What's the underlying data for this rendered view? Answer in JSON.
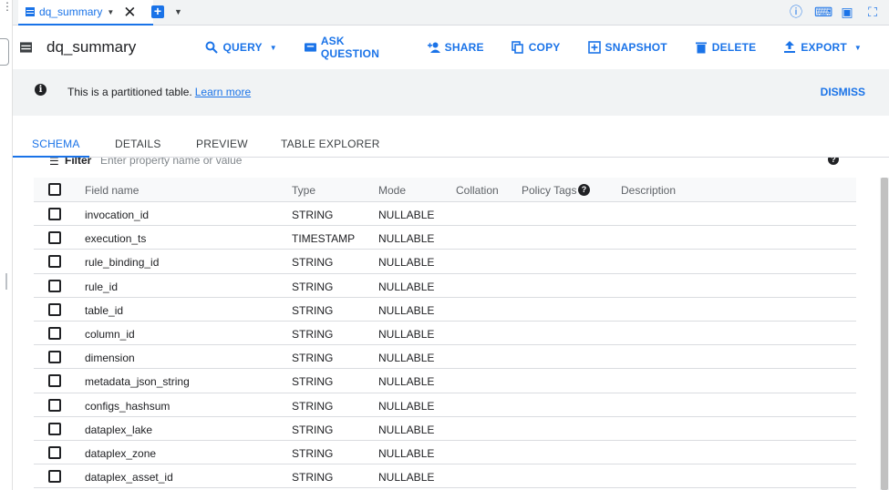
{
  "tab": {
    "label": "dq_summary"
  },
  "toolbar": {
    "title": "dq_summary",
    "query": "QUERY",
    "ask_question": "ASK QUESTION",
    "share": "SHARE",
    "copy": "COPY",
    "snapshot": "SNAPSHOT",
    "delete": "DELETE",
    "export": "EXPORT"
  },
  "banner": {
    "message": "This is a partitioned table.",
    "link": "Learn more",
    "dismiss": "DISMISS"
  },
  "detail_tabs": [
    "SCHEMA",
    "DETAILS",
    "PREVIEW",
    "TABLE EXPLORER"
  ],
  "filter": {
    "label": "Filter",
    "placeholder": "Enter property name or value"
  },
  "columns": {
    "field_name": "Field name",
    "type": "Type",
    "mode": "Mode",
    "collation": "Collation",
    "policy_tags": "Policy Tags",
    "description": "Description"
  },
  "rows": [
    {
      "name": "invocation_id",
      "type": "STRING",
      "mode": "NULLABLE"
    },
    {
      "name": "execution_ts",
      "type": "TIMESTAMP",
      "mode": "NULLABLE"
    },
    {
      "name": "rule_binding_id",
      "type": "STRING",
      "mode": "NULLABLE"
    },
    {
      "name": "rule_id",
      "type": "STRING",
      "mode": "NULLABLE"
    },
    {
      "name": "table_id",
      "type": "STRING",
      "mode": "NULLABLE"
    },
    {
      "name": "column_id",
      "type": "STRING",
      "mode": "NULLABLE"
    },
    {
      "name": "dimension",
      "type": "STRING",
      "mode": "NULLABLE"
    },
    {
      "name": "metadata_json_string",
      "type": "STRING",
      "mode": "NULLABLE"
    },
    {
      "name": "configs_hashsum",
      "type": "STRING",
      "mode": "NULLABLE"
    },
    {
      "name": "dataplex_lake",
      "type": "STRING",
      "mode": "NULLABLE"
    },
    {
      "name": "dataplex_zone",
      "type": "STRING",
      "mode": "NULLABLE"
    },
    {
      "name": "dataplex_asset_id",
      "type": "STRING",
      "mode": "NULLABLE"
    }
  ],
  "colors": {
    "accent": "#1a73e8",
    "banner_bg": "#f1f3f4",
    "text": "#202124"
  }
}
